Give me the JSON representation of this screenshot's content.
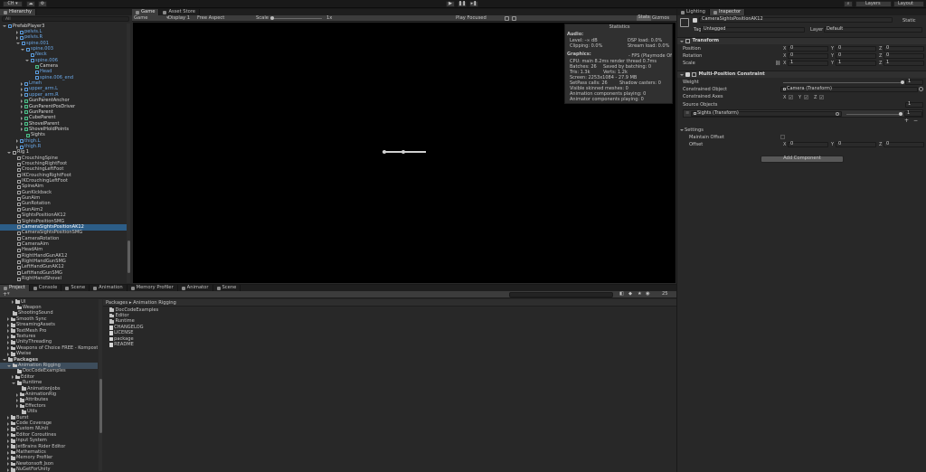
{
  "toolbar": {
    "account_label": "CH ▾",
    "layers_label": "Layers",
    "layout_label": "Layout"
  },
  "hierarchy": {
    "tab_label": "Hierarchy",
    "search_placeholder": "All",
    "items": [
      {
        "label": "PrefabPlayer3",
        "indent": 0,
        "icon": "blue",
        "arrow": "open",
        "color": "#d8d8d8"
      },
      {
        "label": "pelvis.L",
        "indent": 3,
        "icon": "blue",
        "arrow": "closed",
        "color": "#6aa7e6"
      },
      {
        "label": "pelvis.R",
        "indent": 3,
        "icon": "blue",
        "arrow": "closed",
        "color": "#6aa7e6"
      },
      {
        "label": "spine.001",
        "indent": 3,
        "icon": "blue",
        "arrow": "open",
        "color": "#6aa7e6"
      },
      {
        "label": "spine.003",
        "indent": 4,
        "icon": "blue",
        "arrow": "open",
        "color": "#6aa7e6"
      },
      {
        "label": "Neck",
        "indent": 5,
        "icon": "blue",
        "arrow": "none",
        "color": "#6aa7e6"
      },
      {
        "label": "spine.006",
        "indent": 5,
        "icon": "blue",
        "arrow": "open",
        "color": "#6aa7e6"
      },
      {
        "label": "Camera",
        "indent": 6,
        "icon": "green",
        "arrow": "none",
        "color": "#d8d8d8"
      },
      {
        "label": "Head",
        "indent": 6,
        "icon": "blue",
        "arrow": "none",
        "color": "#6aa7e6"
      },
      {
        "label": "spine.006_end",
        "indent": 6,
        "icon": "blue",
        "arrow": "none",
        "color": "#6aa7e6"
      },
      {
        "label": "Lmeh",
        "indent": 4,
        "icon": "blue",
        "arrow": "closed",
        "color": "#6aa7e6"
      },
      {
        "label": "upper_arm.L",
        "indent": 4,
        "icon": "blue",
        "arrow": "closed",
        "color": "#6aa7e6"
      },
      {
        "label": "upper_arm.R",
        "indent": 4,
        "icon": "blue",
        "arrow": "closed",
        "color": "#6aa7e6"
      },
      {
        "label": "GunParentAnchor",
        "indent": 4,
        "icon": "green",
        "arrow": "closed",
        "color": "#d8d8d8"
      },
      {
        "label": "GunParentPosDriver",
        "indent": 4,
        "icon": "green",
        "arrow": "closed",
        "color": "#d8d8d8"
      },
      {
        "label": "GunParent",
        "indent": 4,
        "icon": "green",
        "arrow": "closed",
        "color": "#d8d8d8"
      },
      {
        "label": "CubeParent",
        "indent": 4,
        "icon": "green",
        "arrow": "closed",
        "color": "#d8d8d8"
      },
      {
        "label": "ShovelParent",
        "indent": 4,
        "icon": "green",
        "arrow": "closed",
        "color": "#d8d8d8"
      },
      {
        "label": "ShovelHoldPoints",
        "indent": 4,
        "icon": "green",
        "arrow": "closed",
        "color": "#d8d8d8"
      },
      {
        "label": "Sights",
        "indent": 4,
        "icon": "green",
        "arrow": "none",
        "color": "#d8d8d8"
      },
      {
        "label": "thigh.L",
        "indent": 3,
        "icon": "blue",
        "arrow": "closed",
        "color": "#6aa7e6"
      },
      {
        "label": "thigh.R",
        "indent": 3,
        "icon": "blue",
        "arrow": "closed",
        "color": "#6aa7e6"
      },
      {
        "label": "Rig 1",
        "indent": 1,
        "icon": "plain",
        "arrow": "open",
        "color": "#d8d8d8"
      },
      {
        "label": "CrouchingSpine",
        "indent": 2,
        "icon": "plain",
        "arrow": "none",
        "color": "#c8c8c8"
      },
      {
        "label": "CrouchingRightFoot",
        "indent": 2,
        "icon": "plain",
        "arrow": "none",
        "color": "#c8c8c8"
      },
      {
        "label": "CrouchingLeftFoot",
        "indent": 2,
        "icon": "plain",
        "arrow": "none",
        "color": "#c8c8c8"
      },
      {
        "label": "IKCrouchingRightFoot",
        "indent": 2,
        "icon": "plain",
        "arrow": "none",
        "color": "#c8c8c8"
      },
      {
        "label": "IKCrouchingLeftFoot",
        "indent": 2,
        "icon": "plain",
        "arrow": "none",
        "color": "#c8c8c8"
      },
      {
        "label": "SpineAim",
        "indent": 2,
        "icon": "plain",
        "arrow": "none",
        "color": "#c8c8c8"
      },
      {
        "label": "GunKickback",
        "indent": 2,
        "icon": "plain",
        "arrow": "none",
        "color": "#c8c8c8"
      },
      {
        "label": "GunAim",
        "indent": 2,
        "icon": "plain",
        "arrow": "none",
        "color": "#c8c8c8"
      },
      {
        "label": "GunRotation",
        "indent": 2,
        "icon": "plain",
        "arrow": "none",
        "color": "#c8c8c8"
      },
      {
        "label": "GunAim2",
        "indent": 2,
        "icon": "plain",
        "arrow": "none",
        "color": "#c8c8c8"
      },
      {
        "label": "SightsPositionAK12",
        "indent": 2,
        "icon": "plain",
        "arrow": "none",
        "color": "#c8c8c8"
      },
      {
        "label": "SightsPositionSMG",
        "indent": 2,
        "icon": "plain",
        "arrow": "none",
        "color": "#c8c8c8"
      },
      {
        "label": "CameraSightsPositionAK12",
        "indent": 2,
        "icon": "plain",
        "arrow": "none",
        "color": "#ffffff",
        "selected": true
      },
      {
        "label": "CameraSightsPositionSMG",
        "indent": 2,
        "icon": "plain",
        "arrow": "none",
        "color": "#c8c8c8"
      },
      {
        "label": "CameraRotation",
        "indent": 2,
        "icon": "plain",
        "arrow": "none",
        "color": "#c8c8c8"
      },
      {
        "label": "CameraAim",
        "indent": 2,
        "icon": "plain",
        "arrow": "none",
        "color": "#c8c8c8"
      },
      {
        "label": "HeadAim",
        "indent": 2,
        "icon": "plain",
        "arrow": "none",
        "color": "#c8c8c8"
      },
      {
        "label": "RightHandGunAK12",
        "indent": 2,
        "icon": "plain",
        "arrow": "none",
        "color": "#c8c8c8"
      },
      {
        "label": "RightHandGunSMG",
        "indent": 2,
        "icon": "plain",
        "arrow": "none",
        "color": "#c8c8c8"
      },
      {
        "label": "LeftHandGunAK12",
        "indent": 2,
        "icon": "plain",
        "arrow": "none",
        "color": "#c8c8c8"
      },
      {
        "label": "LeftHandGunSMG",
        "indent": 2,
        "icon": "plain",
        "arrow": "none",
        "color": "#c8c8c8"
      },
      {
        "label": "RightHandShovel",
        "indent": 2,
        "icon": "plain",
        "arrow": "none",
        "color": "#c8c8c8"
      }
    ]
  },
  "game": {
    "tabs": [
      "Game",
      "Asset Store"
    ],
    "display_mode": "Game",
    "display": "Display 1",
    "aspect": "Free Aspect",
    "scale_label": "Scale",
    "scale_value": "1x",
    "play_mode": "Play Focused",
    "stats_button": "Stats",
    "gizmos_button": "Gizmos"
  },
  "statistics": {
    "title": "Statistics",
    "audio_header": "Audio:",
    "level": "Level: -∞ dB",
    "clipping": "Clipping: 0.0%",
    "dsp_load": "DSP load: 0.0%",
    "stream_load": "Stream load: 0.0%",
    "graphics_header": "Graphics:",
    "fps": "- FPS (Playmode Of",
    "cpu": "CPU: main 8.2ms  render thread 0.7ms",
    "batches": "Batches: 26",
    "saved_batching": "Saved by batching: 0",
    "tris": "Tris: 1.3k",
    "verts": "Verts: 1.2k",
    "screen": "Screen: 2253x1084 - 27.9 MB",
    "setpass": "SetPass calls: 26",
    "shadow_casters": "Shadow casters: 0",
    "visible_skinned": "Visible skinned meshes: 0",
    "anim_components": "Animation components playing: 0",
    "animator_components": "Animator components playing: 0"
  },
  "project": {
    "tabs": [
      "Project",
      "Console",
      "Scene",
      "Animation",
      "Memory Profiler",
      "Animator",
      "Scene"
    ],
    "breadcrumb": "Packages ▸ Animation Rigging",
    "hidden_count": "25",
    "tree": [
      {
        "label": "UI",
        "indent": 2,
        "arrow": "closed"
      },
      {
        "label": "Weapon",
        "indent": 2,
        "arrow": "none"
      },
      {
        "label": "ShootingSound",
        "indent": 1,
        "arrow": "none"
      },
      {
        "label": "Smooth Sync",
        "indent": 1,
        "arrow": "closed"
      },
      {
        "label": "StreamingAssets",
        "indent": 1,
        "arrow": "closed"
      },
      {
        "label": "TextMesh Pro",
        "indent": 1,
        "arrow": "closed"
      },
      {
        "label": "Textures",
        "indent": 1,
        "arrow": "closed"
      },
      {
        "label": "UnityThreading",
        "indent": 1,
        "arrow": "closed"
      },
      {
        "label": "Weapons of Choice FREE - Komposte",
        "indent": 1,
        "arrow": "closed"
      },
      {
        "label": "Wwise",
        "indent": 1,
        "arrow": "closed"
      },
      {
        "label": "Packages",
        "indent": 0,
        "arrow": "open",
        "bold": true
      },
      {
        "label": "Animation Rigging",
        "indent": 1,
        "arrow": "open",
        "selected": true
      },
      {
        "label": "DocCodeExamples",
        "indent": 2,
        "arrow": "none"
      },
      {
        "label": "Editor",
        "indent": 2,
        "arrow": "closed"
      },
      {
        "label": "Runtime",
        "indent": 2,
        "arrow": "open"
      },
      {
        "label": "AnimationJobs",
        "indent": 3,
        "arrow": "none"
      },
      {
        "label": "AnimationRig",
        "indent": 3,
        "arrow": "closed"
      },
      {
        "label": "Attributes",
        "indent": 3,
        "arrow": "closed"
      },
      {
        "label": "Effectors",
        "indent": 3,
        "arrow": "closed"
      },
      {
        "label": "Utils",
        "indent": 3,
        "arrow": "none"
      },
      {
        "label": "Burst",
        "indent": 1,
        "arrow": "closed"
      },
      {
        "label": "Code Coverage",
        "indent": 1,
        "arrow": "closed"
      },
      {
        "label": "Custom NUnit",
        "indent": 1,
        "arrow": "closed"
      },
      {
        "label": "Editor Coroutines",
        "indent": 1,
        "arrow": "closed"
      },
      {
        "label": "Input System",
        "indent": 1,
        "arrow": "closed"
      },
      {
        "label": "JetBrains Rider Editor",
        "indent": 1,
        "arrow": "closed"
      },
      {
        "label": "Mathematics",
        "indent": 1,
        "arrow": "closed"
      },
      {
        "label": "Memory Profiler",
        "indent": 1,
        "arrow": "closed"
      },
      {
        "label": "Newtonsoft Json",
        "indent": 1,
        "arrow": "closed"
      },
      {
        "label": "NuGetForUnity",
        "indent": 1,
        "arrow": "closed"
      }
    ],
    "files": [
      {
        "label": "DocCodeExamples",
        "type": "folder"
      },
      {
        "label": "Editor",
        "type": "folder"
      },
      {
        "label": "Runtime",
        "type": "folder"
      },
      {
        "label": "CHANGELOG",
        "type": "file"
      },
      {
        "label": "LICENSE",
        "type": "file"
      },
      {
        "label": "package",
        "type": "file"
      },
      {
        "label": "README",
        "type": "file"
      }
    ]
  },
  "inspector": {
    "tabs": [
      "Lighting",
      "Inspector"
    ],
    "object_name": "CameraSightsPositionAK12",
    "static_label": "Static",
    "tag_label": "Tag",
    "tag_value": "Untagged",
    "layer_label": "Layer",
    "layer_value": "Default",
    "transform": {
      "title": "Transform",
      "position_label": "Position",
      "rotation_label": "Rotation",
      "scale_label": "Scale",
      "position": [
        "0",
        "0",
        "0"
      ],
      "rotation": [
        "0",
        "0",
        "0"
      ],
      "scale": [
        "1",
        "1",
        "1"
      ]
    },
    "mpc": {
      "title": "Multi-Position Constraint",
      "weight_label": "Weight",
      "weight_value": "1",
      "weight_fraction": 1.0,
      "constrained_object_label": "Constrained Object",
      "constrained_object_value": "Camera (Transform)",
      "constrained_axes_label": "Constrained Axes",
      "axes": [
        "X",
        "Y",
        "Z"
      ],
      "source_objects_label": "Source Objects",
      "source_count": "1",
      "source_value": "Sights (Transform)",
      "source_weight": "1",
      "settings_label": "Settings",
      "maintain_offset_label": "Maintain Offset",
      "offset_label": "Offset",
      "offset": [
        "0",
        "0",
        "0"
      ]
    },
    "add_component": "Add Component"
  }
}
